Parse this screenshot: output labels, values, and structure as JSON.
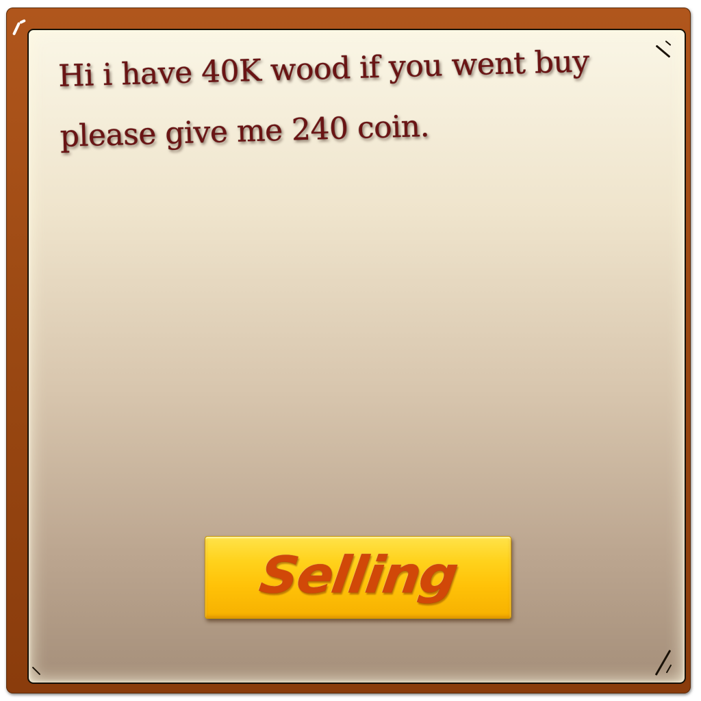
{
  "dialog": {
    "message_lines": [
      "Hi i have 40K wood if you went buy",
      "please give me 240 coin."
    ],
    "sell_button_label": "Selling"
  },
  "colors": {
    "frame": "#9a4812",
    "panel_top": "#faf6e6",
    "panel_bottom": "#a58f7a",
    "message_text": "#6a1414",
    "button_fill": "#ffc208",
    "button_text": "#d14808"
  },
  "icons": {
    "corners": "corner-scratch-marks"
  }
}
